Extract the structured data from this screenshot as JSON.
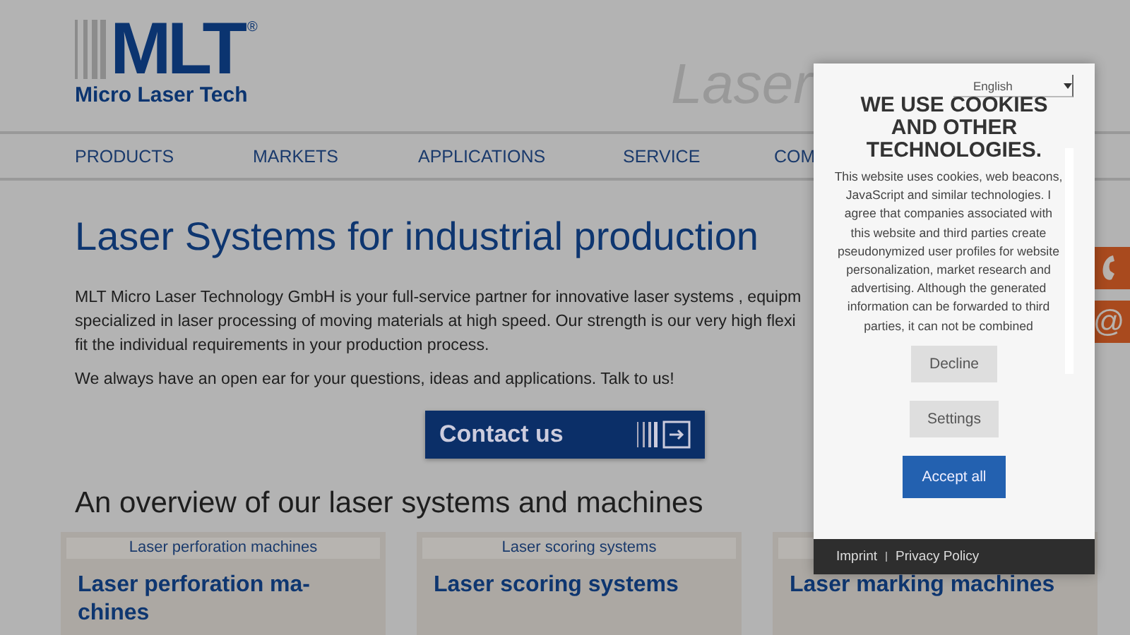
{
  "header": {
    "logo_mark": "MLT",
    "logo_registered": "®",
    "logo_text": "Micro **Laser** Tech",
    "tagline": "Laser"
  },
  "nav": [
    {
      "label": "PRODUCTS"
    },
    {
      "label": "MARKETS"
    },
    {
      "label": "APPLICATIONS"
    },
    {
      "label": "SERVICE"
    },
    {
      "label": "COM"
    }
  ],
  "heading": "Laser Systems for industrial production",
  "intro_lines": [
    "MLT Micro Laser Technology GmbH is your full-service partner for innovative laser systems , equipm",
    "specialized in laser processing of moving materials at high speed. Our strength is our very high flexi",
    "fit the individual requirements in your production process."
  ],
  "intro_2": "We always have an open ear for your questions, ideas and applications. Talk to us!",
  "contact_button": "Contact us",
  "overview_heading": "An overview of our laser systems and machines",
  "cards": [
    {
      "label": "Laser perforation machines",
      "title_lines": [
        "Laser perforation ma-",
        "chines"
      ]
    },
    {
      "label": "Laser scoring systems",
      "title_lines": [
        "Laser scoring systems"
      ]
    },
    {
      "title_lines": [
        "Laser marking machines"
      ]
    }
  ],
  "side_tabs": [
    {
      "kind": "phone"
    },
    {
      "kind": "email",
      "text": "@"
    }
  ],
  "cookie": {
    "language": "English",
    "title": "WE USE COOKIES AND OTHER TECHNOLOGIES.",
    "text": "This website uses cookies, web beacons, JavaScript and similar technologies. I agree that companies associated with this website and third parties create pseudonymized user profiles for website personalization, market research and advertising. Although the generated information can be forwarded to third parties, it can not be combined",
    "buttons": [
      {
        "label": "Decline",
        "kind": "secondary"
      },
      {
        "label": "Settings",
        "kind": "secondary"
      },
      {
        "label": "Accept all",
        "kind": "primary"
      }
    ],
    "links": [
      "Imprint",
      "Privacy Policy"
    ]
  }
}
